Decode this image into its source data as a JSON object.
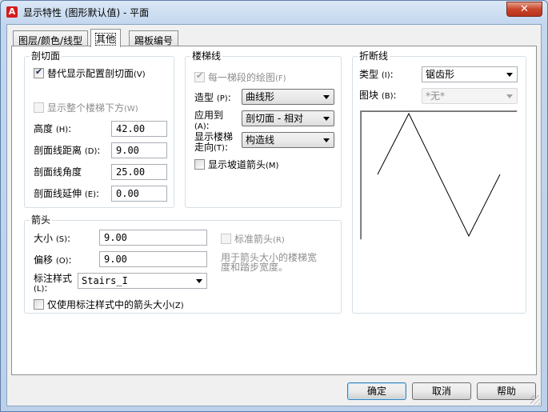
{
  "window": {
    "title": "显示特性 (图形默认值) - 平面",
    "close_label": "✕",
    "app_icon_label": "A"
  },
  "tabs": [
    {
      "label": "图层/颜色/线型",
      "active": false
    },
    {
      "label": "其他",
      "active": true
    },
    {
      "label": "踢板编号",
      "active": false
    }
  ],
  "cut_plane": {
    "title": "剖切面",
    "override_label": "替代显示配置剖切面",
    "override_key": "(V)",
    "override_checked": true,
    "show_whole_label": "显示整个楼梯下方",
    "show_whole_key": "(W)",
    "show_whole_checked": false,
    "fields": [
      {
        "label": "高度",
        "key": "(H)",
        "value": "42.00"
      },
      {
        "label": "剖面线距离",
        "key": "(D)",
        "value": "9.00"
      },
      {
        "label": "剖面线角度",
        "key": "",
        "value": "25.00"
      },
      {
        "label": "剖面线延伸",
        "key": "(E)",
        "value": "0.00"
      }
    ]
  },
  "stair_line": {
    "title": "楼梯线",
    "each_flight_label": "每一梯段的绘图",
    "each_flight_key": "(F)",
    "each_flight_checked": true,
    "shape_label": "造型",
    "shape_key": "(P)",
    "shape_value": "曲线形",
    "apply_label_1": "应用到",
    "apply_label_2": "(A)",
    "apply_value": "剖切面 - 相对",
    "show_dir_label_1": "显示楼梯",
    "show_dir_label_2": "走向",
    "show_dir_key": "(T)",
    "show_dir_value": "构造线",
    "ramp_arrow_label": "显示坡道箭头",
    "ramp_arrow_key": "(M)",
    "ramp_arrow_checked": false
  },
  "break_line": {
    "title": "折断线",
    "type_label": "类型",
    "type_key": "(I)",
    "type_value": "锯齿形",
    "block_label": "图块",
    "block_key": "(B)",
    "block_value": "*无*"
  },
  "arrow": {
    "title": "箭头",
    "size_label": "大小",
    "size_key": "(S)",
    "size_value": "9.00",
    "offset_label": "偏移",
    "offset_key": "(O)",
    "offset_value": "9.00",
    "style_label_1": "标注样式",
    "style_label_2": "(L)",
    "style_value": "Stairs_I",
    "use_style_label": "仅使用标注样式中的箭头大小",
    "use_style_key": "(Z)",
    "use_style_checked": false,
    "std_arrow_label": "标准箭头",
    "std_arrow_key": "(R)",
    "std_arrow_checked": false,
    "hint_line_1": "用于箭头大小的楼梯宽",
    "hint_line_2": "度和踏步宽度。"
  },
  "buttons": {
    "ok": "确定",
    "cancel": "取消",
    "help": "帮助"
  }
}
